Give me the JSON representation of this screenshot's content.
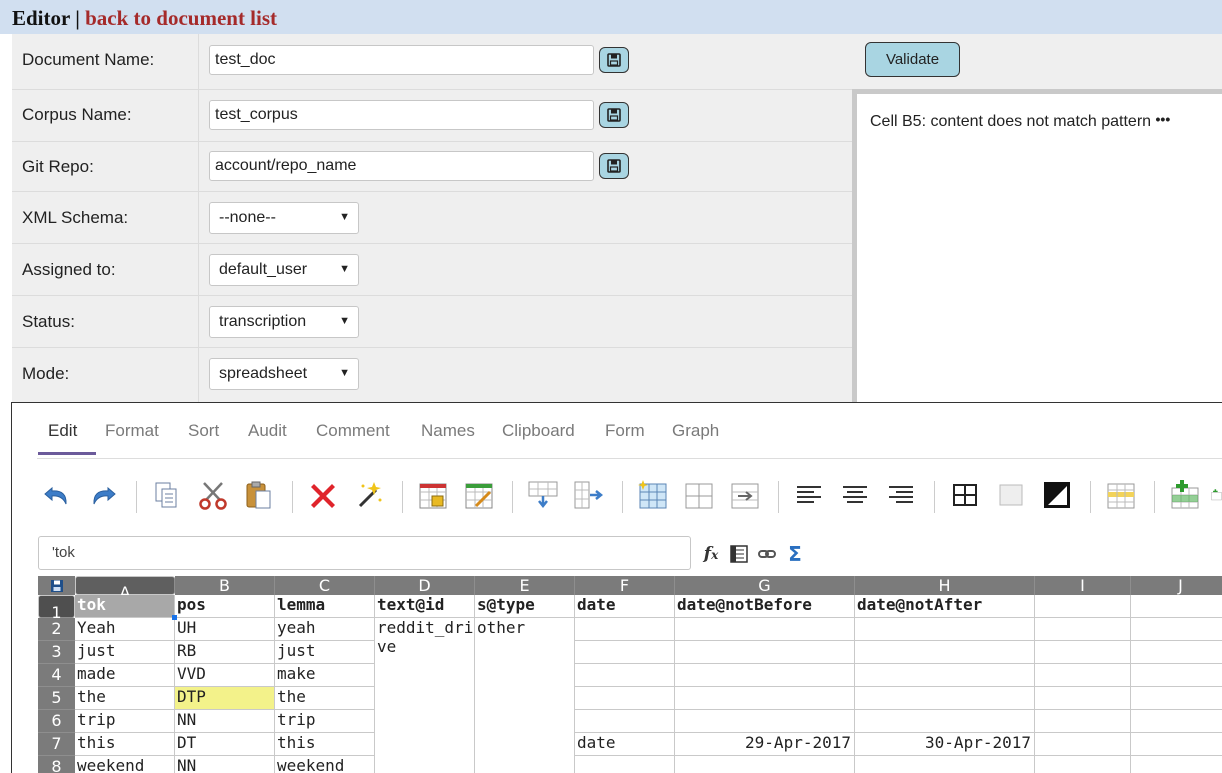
{
  "header": {
    "title": "Editor |",
    "back_link": "back to document list"
  },
  "form": {
    "document_name": {
      "label": "Document Name:",
      "value": "test_doc"
    },
    "corpus_name": {
      "label": "Corpus Name:",
      "value": "test_corpus"
    },
    "git_repo": {
      "label": "Git Repo:",
      "value": "account/repo_name"
    },
    "xml_schema": {
      "label": "XML Schema:",
      "selected": "--none--"
    },
    "assigned_to": {
      "label": "Assigned to:",
      "selected": "default_user"
    },
    "status": {
      "label": "Status:",
      "selected": "transcription"
    },
    "mode": {
      "label": "Mode:",
      "selected": "spreadsheet"
    }
  },
  "validate": {
    "button_label": "Validate",
    "message": "Cell B5: content does not match pattern",
    "more_icon": "ellipsis-icon"
  },
  "sheet": {
    "tabs": [
      "Edit",
      "Format",
      "Sort",
      "Audit",
      "Comment",
      "Names",
      "Clipboard",
      "Form",
      "Graph"
    ],
    "active_tab": "Edit",
    "formula_value": "'tok",
    "columns": [
      "A",
      "B",
      "C",
      "D",
      "E",
      "F",
      "G",
      "H",
      "I",
      "J"
    ],
    "rows": [
      "1",
      "2",
      "3",
      "4",
      "5",
      "6",
      "7",
      "8"
    ],
    "cells": {
      "A1": "tok",
      "B1": "pos",
      "C1": "lemma",
      "D1": "text@id",
      "E1": "s@type",
      "F1": "date",
      "G1": "date@notBefore",
      "H1": "date@notAfter",
      "A2": "Yeah",
      "B2": "UH",
      "C2": "yeah",
      "D2": "reddit_drive",
      "E2": "other",
      "A3": "just",
      "B3": "RB",
      "C3": "just",
      "A4": "made",
      "B4": "VVD",
      "C4": "make",
      "A5": "the",
      "B5": "DTP",
      "C5": "the",
      "A6": "trip",
      "B6": "NN",
      "C6": "trip",
      "A7": "this",
      "B7": "DT",
      "C7": "this",
      "F7": "date",
      "G7": "29-Apr-2017",
      "H7": "30-Apr-2017",
      "A8": "weekend",
      "B8": "NN",
      "C8": "weekend"
    },
    "error_cell_color": "#f3f28a",
    "selected_cell_color": "#a8a8a8"
  },
  "colors": {
    "topbar": "#d1dff0",
    "link": "#a52a2a",
    "button": "#a9d5e2",
    "panel": "#efefef"
  }
}
